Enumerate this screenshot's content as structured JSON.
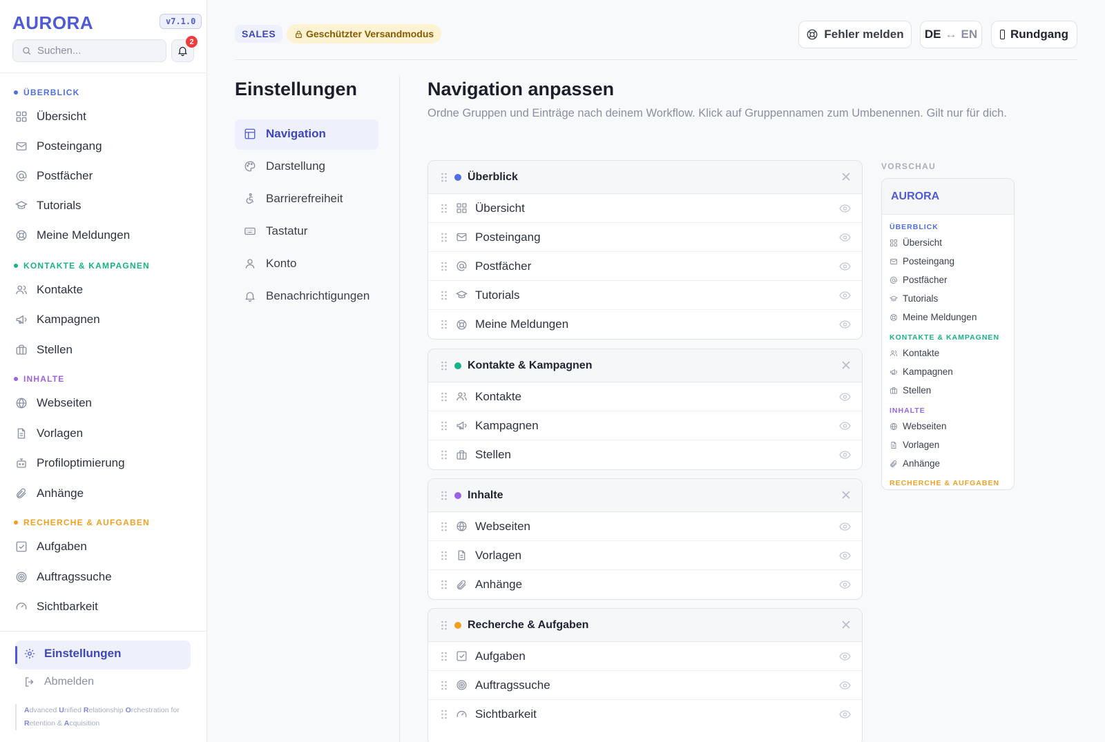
{
  "app": {
    "brand": "AURORA",
    "version": "v7.1.0"
  },
  "search": {
    "placeholder": "Suchen..."
  },
  "notifications": {
    "count": "2"
  },
  "sidebar": {
    "groups": [
      {
        "label": "ÜBERBLICK",
        "color": "#4f6fe0",
        "items": [
          "Übersicht",
          "Posteingang",
          "Postfächer",
          "Tutorials",
          "Meine Meldungen"
        ]
      },
      {
        "label": "KONTAKTE & KAMPAGNEN",
        "color": "#17b285",
        "items": [
          "Kontakte",
          "Kampagnen",
          "Stellen"
        ]
      },
      {
        "label": "INHALTE",
        "color": "#9a62e8",
        "items": [
          "Webseiten",
          "Vorlagen",
          "Profiloptimierung",
          "Anhänge"
        ]
      },
      {
        "label": "RECHERCHE & AUFGABEN",
        "color": "#f0a020",
        "items": [
          "Aufgaben",
          "Auftragssuche",
          "Sichtbarkeit"
        ]
      }
    ],
    "settings_label": "Einstellungen",
    "logout_label": "Abmelden",
    "tagline": {
      "l1": "A",
      "t1": "dvanced ",
      "l2": "U",
      "t2": "nified ",
      "l3": "R",
      "t3": "elationship ",
      "l4": "O",
      "t4": "rchestration for ",
      "l5": "R",
      "t5": "etention & ",
      "l6": "A",
      "t6": "cquisition"
    }
  },
  "topbar": {
    "sales_badge": "SALES",
    "protect_badge": "Geschützter Versandmodus",
    "report_label": "Fehler melden",
    "lang_de": "DE",
    "lang_arrow": "↔",
    "lang_en": "EN",
    "tour_label": "Rundgang"
  },
  "settings": {
    "title": "Einstellungen",
    "items": [
      "Navigation",
      "Darstellung",
      "Barrierefreiheit",
      "Tastatur",
      "Konto",
      "Benachrichtigungen"
    ]
  },
  "main": {
    "title": "Navigation anpassen",
    "description": "Ordne Gruppen und Einträge nach deinem Workflow. Klick auf Gruppennamen zum Umbenennen. Gilt nur für dich.",
    "cards": [
      {
        "title": "Überblick",
        "color": "#4f6fe0",
        "items": [
          "Übersicht",
          "Posteingang",
          "Postfächer",
          "Tutorials",
          "Meine Meldungen"
        ]
      },
      {
        "title": "Kontakte & Kampagnen",
        "color": "#17b285",
        "items": [
          "Kontakte",
          "Kampagnen",
          "Stellen"
        ]
      },
      {
        "title": "Inhalte",
        "color": "#9a62e8",
        "items": [
          "Webseiten",
          "Vorlagen",
          "Anhänge"
        ]
      },
      {
        "title": "Recherche & Aufgaben",
        "color": "#f0a020",
        "items": [
          "Aufgaben",
          "Auftragssuche",
          "Sichtbarkeit"
        ]
      }
    ]
  },
  "preview": {
    "label": "VORSCHAU",
    "brand": "AURORA",
    "groups": [
      {
        "label": "ÜBERBLICK",
        "color": "#4f6fe0",
        "items": [
          "Übersicht",
          "Posteingang",
          "Postfächer",
          "Tutorials",
          "Meine Meldungen"
        ]
      },
      {
        "label": "KONTAKTE & KAMPAGNEN",
        "color": "#17b285",
        "items": [
          "Kontakte",
          "Kampagnen",
          "Stellen"
        ]
      },
      {
        "label": "INHALTE",
        "color": "#9a62e8",
        "items": [
          "Webseiten",
          "Vorlagen",
          "Anhänge"
        ]
      },
      {
        "label": "RECHERCHE & AUFGABEN",
        "color": "#f0a020",
        "items": []
      }
    ]
  }
}
